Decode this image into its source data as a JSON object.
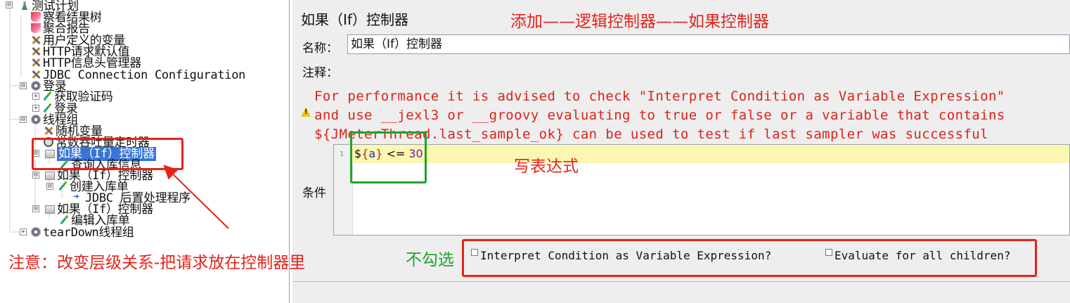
{
  "tree": {
    "items": [
      {
        "label": "测试计划",
        "icon": "test-plan-icon"
      },
      {
        "label": "察看结果树",
        "icon": "listener-icon"
      },
      {
        "label": "聚合报告",
        "icon": "listener-icon"
      },
      {
        "label": "用户定义的变量",
        "icon": "config-icon"
      },
      {
        "label": "HTTP请求默认值",
        "icon": "config-icon"
      },
      {
        "label": "HTTP信息头管理器",
        "icon": "config-icon"
      },
      {
        "label": "JDBC Connection Configuration",
        "icon": "config-icon"
      },
      {
        "label": "登录",
        "icon": "thread-group-icon"
      },
      {
        "label": "获取验证码",
        "icon": "sampler-icon"
      },
      {
        "label": "登录",
        "icon": "sampler-icon"
      },
      {
        "label": "线程组",
        "icon": "thread-group-icon"
      },
      {
        "label": "随机变量",
        "icon": "config-icon"
      },
      {
        "label": "常数吞吐量定时器",
        "icon": "timer-icon"
      },
      {
        "label": "如果（If）控制器",
        "icon": "controller-icon"
      },
      {
        "label": "查询入库信息",
        "icon": "sampler-icon"
      },
      {
        "label": "如果（If）控制器",
        "icon": "controller-icon"
      },
      {
        "label": "创建入库单",
        "icon": "sampler-icon"
      },
      {
        "label": "JDBC 后置处理程序",
        "icon": "post-processor-icon"
      },
      {
        "label": "如果（If）控制器",
        "icon": "controller-icon"
      },
      {
        "label": "编辑入库单",
        "icon": "sampler-icon"
      },
      {
        "label": "tearDown线程组",
        "icon": "thread-group-icon"
      }
    ]
  },
  "panel": {
    "title": "如果（If）控制器",
    "name_label": "名称：",
    "name_value": "如果（If）控制器",
    "comment_label": "注释：",
    "comment_value": "",
    "warning_lines": [
      "For performance it is advised to check \"Interpret Condition as Variable Expression\"",
      "and use __jexl3 or __groovy evaluating to true or false or a variable that contains",
      "${JMeterThread.last_sample_ok} can be used to test if last sampler was successful"
    ],
    "condition_label": "条件",
    "editor": {
      "line_number": "1",
      "code_dollar": "$",
      "code_open": "{",
      "code_var": "a",
      "code_close": "}",
      "code_op": " <= ",
      "code_num": "30"
    },
    "checkbox_interpret": "Interpret Condition as Variable Expression?",
    "checkbox_evaluate": "Evaluate for all children?",
    "checkbox_interpret_checked": false,
    "checkbox_evaluate_checked": false
  },
  "annotations": {
    "top": "添加——逻辑控制器——如果控制器",
    "expression": "写表达式",
    "uncheck": "不勾选",
    "note": "注意：改变层级关系-把请求放在控制器里"
  },
  "colors": {
    "annotation_red": "#e6221b",
    "annotation_green": "#1fa32a",
    "selection": "#3875d7",
    "warning_text": "#e0201a"
  }
}
